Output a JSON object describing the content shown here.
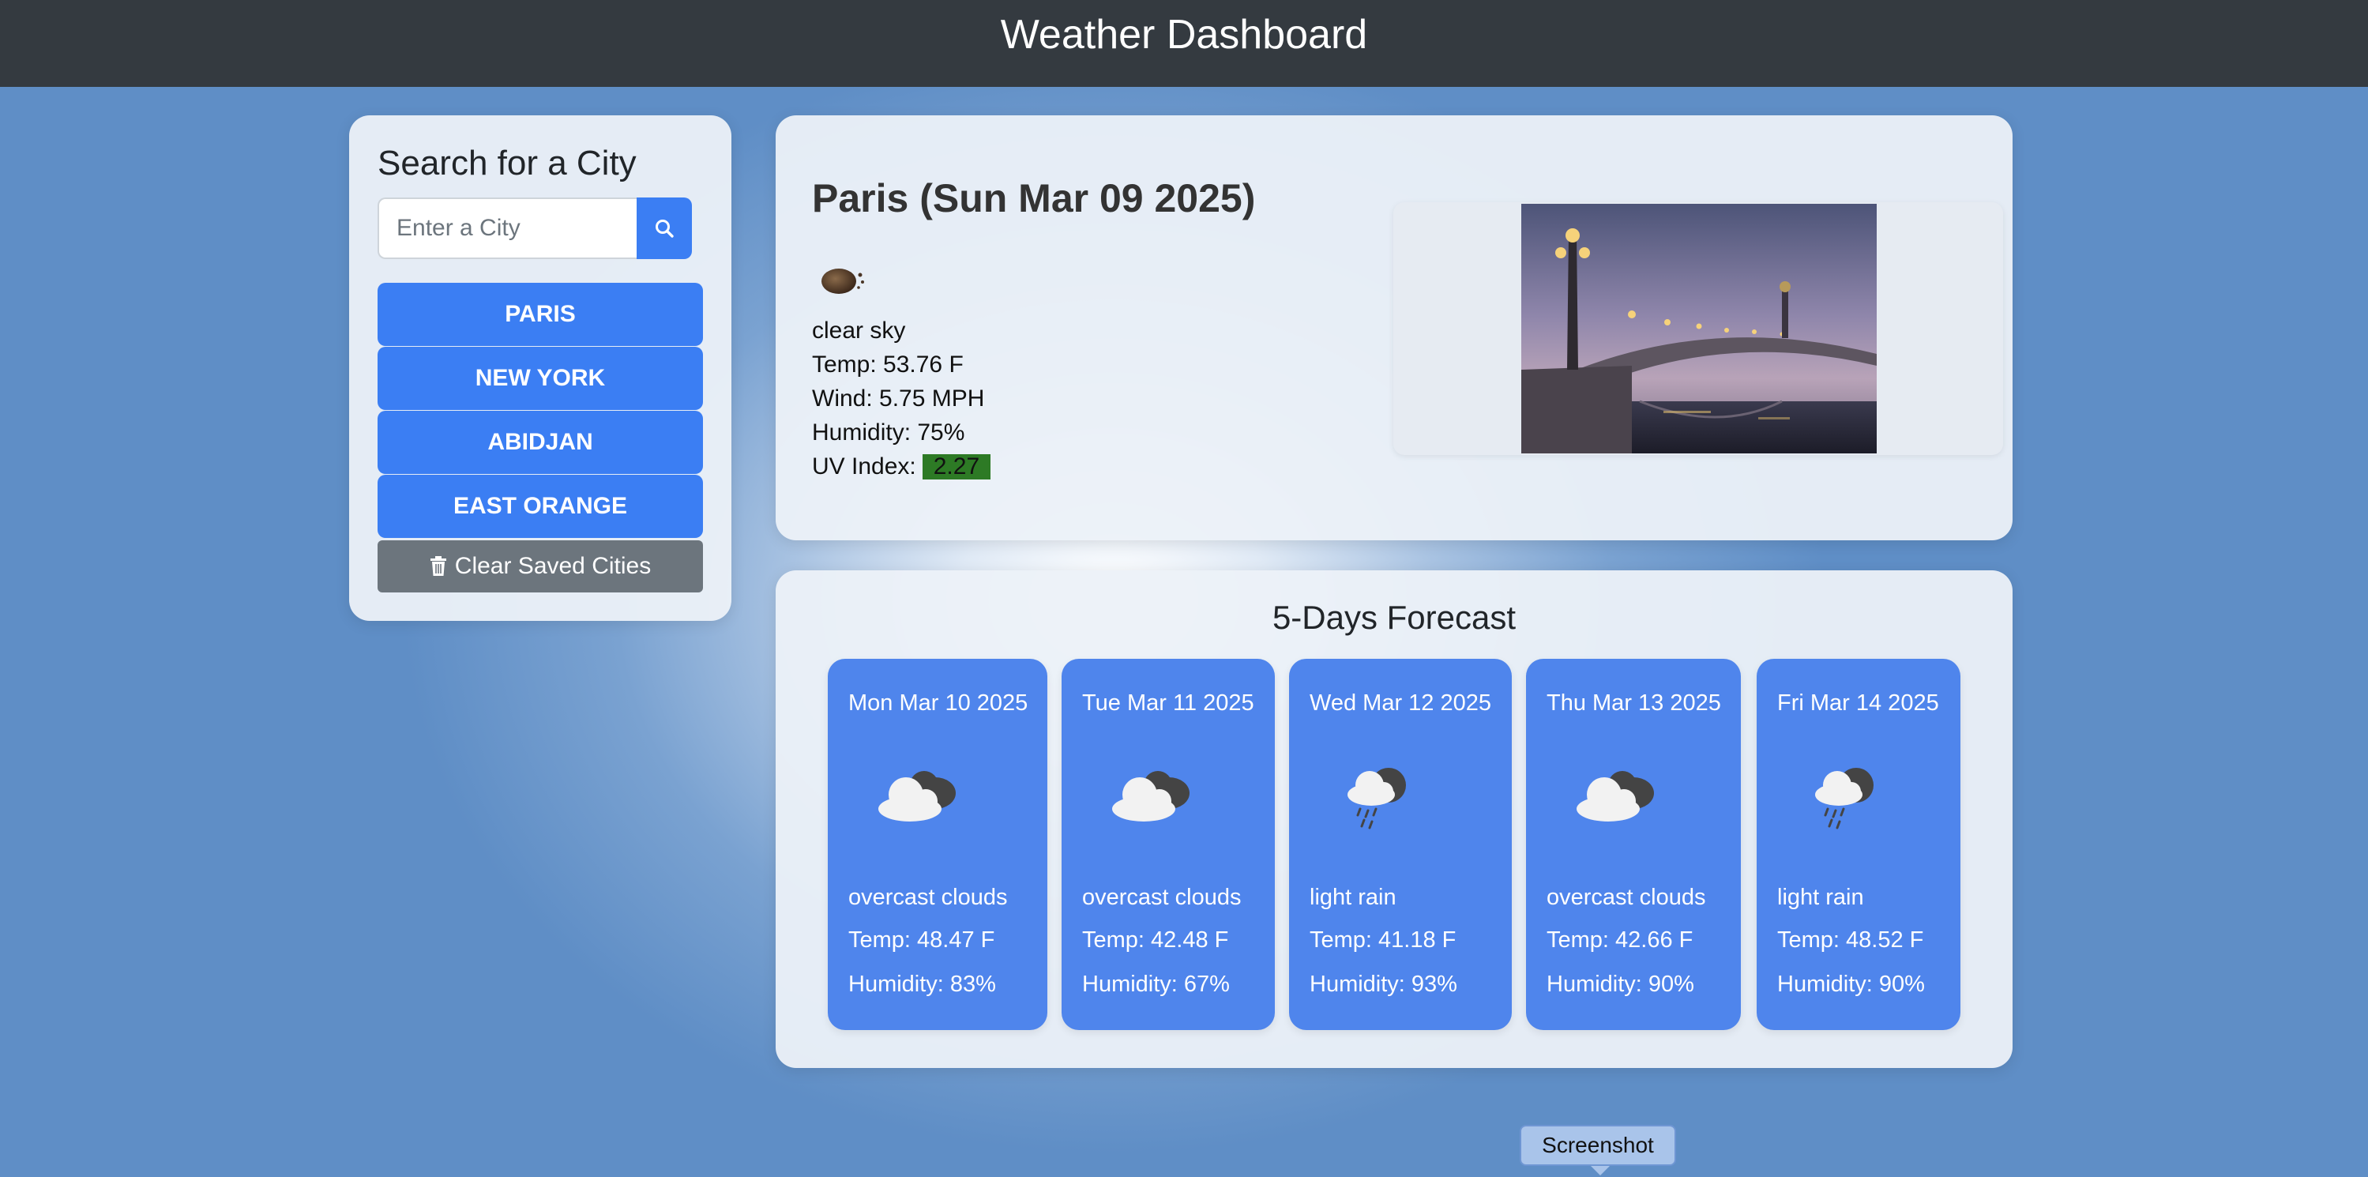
{
  "header": {
    "title": "Weather Dashboard"
  },
  "sidebar": {
    "heading": "Search for a City",
    "search_placeholder": "Enter a City",
    "search_icon": "search-icon",
    "saved_cities": [
      "PARIS",
      "NEW YORK",
      "ABIDJAN",
      "EAST ORANGE"
    ],
    "clear_label": "Clear Saved Cities",
    "clear_icon": "trash-icon"
  },
  "current": {
    "title": "Paris (Sun Mar 09 2025)",
    "icon": "clear-sky-icon",
    "description": "clear sky",
    "temp": "Temp: 53.76 F",
    "wind": "Wind: 5.75 MPH",
    "humidity": "Humidity: 75%",
    "uv_label": "UV Index:",
    "uv_value": "2.27",
    "uv_color": "#2d7a25"
  },
  "forecast": {
    "heading": "5-Days Forecast",
    "days": [
      {
        "date": "Mon Mar 10 2025",
        "icon": "overcast-clouds-icon",
        "description": "overcast clouds",
        "temp": "Temp: 48.47 F",
        "humidity": "Humidity: 83%"
      },
      {
        "date": "Tue Mar 11 2025",
        "icon": "overcast-clouds-icon",
        "description": "overcast clouds",
        "temp": "Temp: 42.48 F",
        "humidity": "Humidity: 67%"
      },
      {
        "date": "Wed Mar 12 2025",
        "icon": "light-rain-icon",
        "description": "light rain",
        "temp": "Temp: 41.18 F",
        "humidity": "Humidity: 93%"
      },
      {
        "date": "Thu Mar 13 2025",
        "icon": "overcast-clouds-icon",
        "description": "overcast clouds",
        "temp": "Temp: 42.66 F",
        "humidity": "Humidity: 90%"
      },
      {
        "date": "Fri Mar 14 2025",
        "icon": "light-rain-icon",
        "description": "light rain",
        "temp": "Temp: 48.52 F",
        "humidity": "Humidity: 90%"
      }
    ]
  },
  "tooltip": {
    "label": "Screenshot"
  },
  "colors": {
    "accent": "#3b7ef3",
    "forecast_card": "#4f85ec",
    "header_bg": "#343a40",
    "clear_button": "#6c757d"
  }
}
